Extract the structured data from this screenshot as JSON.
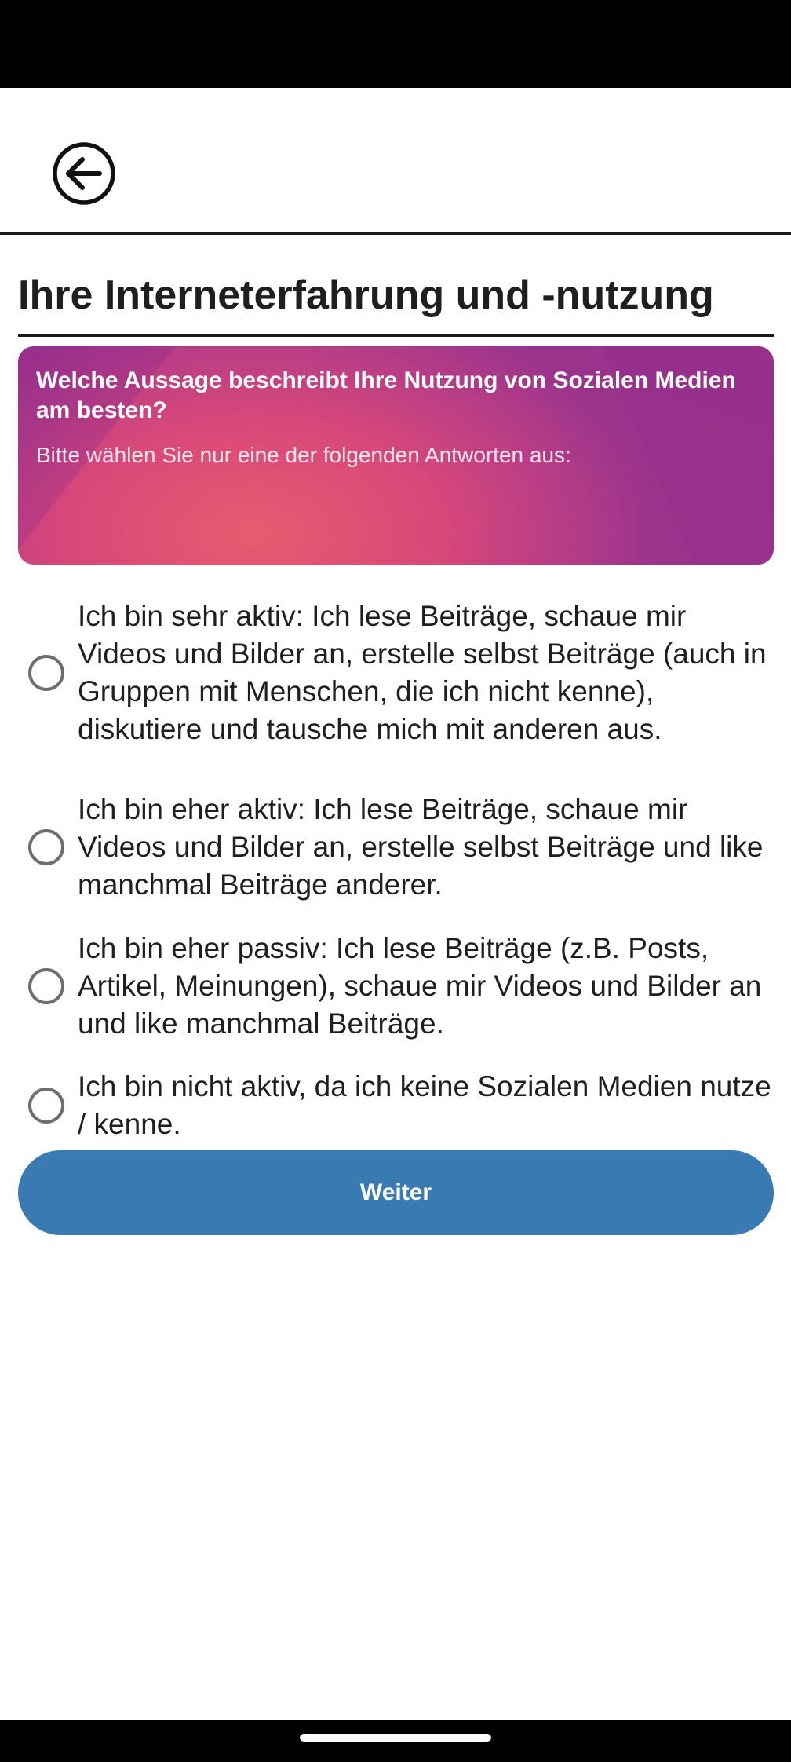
{
  "header": {
    "back_icon": "arrow-left-circle-icon"
  },
  "page": {
    "title": "Ihre Interneterfahrung und -nutzung"
  },
  "question": {
    "text": "Welche Aussage beschreibt Ihre Nutzung von Sozialen Medien am besten?",
    "hint": "Bitte wählen Sie nur eine der folgenden Antworten aus:",
    "gradient_colors": [
      "#e85b6e",
      "#d94879",
      "#b83d86",
      "#99338c"
    ]
  },
  "options": [
    {
      "label": "Ich bin sehr aktiv: Ich lese Beiträge, schaue mir Videos und Bilder an, erstelle selbst Beiträge (auch in Gruppen mit Menschen, die ich nicht kenne), diskutiere und tausche mich mit anderen aus.",
      "selected": false
    },
    {
      "label": "Ich bin eher aktiv: Ich lese Beiträge, schaue mir Videos und Bilder an, erstelle selbst Beiträge und like manchmal Beiträge anderer.",
      "selected": false
    },
    {
      "label": "Ich bin eher passiv: Ich lese Beiträge (z.B. Posts, Artikel, Meinungen), schaue mir Videos und Bilder an und like manchmal Beiträge.",
      "selected": false
    },
    {
      "label": "Ich bin nicht aktiv, da ich keine Sozialen Medien nutze / kenne.",
      "selected": false
    }
  ],
  "actions": {
    "next_label": "Weiter",
    "next_color": "#3a7ab2"
  }
}
